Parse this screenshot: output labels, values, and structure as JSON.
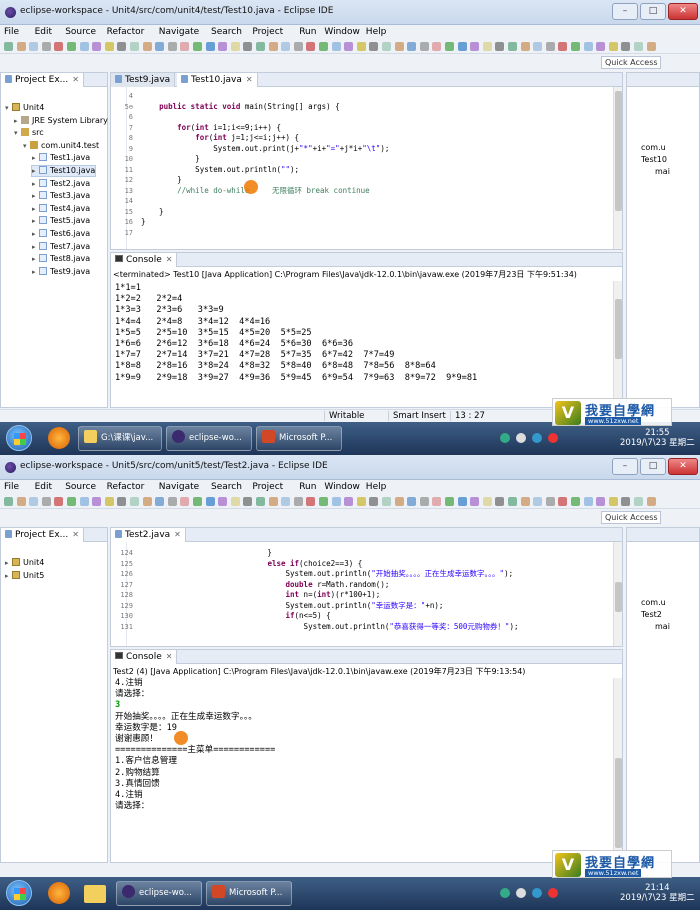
{
  "s1": {
    "title": "eclipse-workspace - Unit4/src/com/unit4/test/Test10.java - Eclipse IDE",
    "menus": [
      "File",
      "Edit",
      "Source",
      "Refactor",
      "Navigate",
      "Search",
      "Project",
      "Run",
      "Window",
      "Help"
    ],
    "quick_access": "Quick Access",
    "explorer_tab": "Project Ex...",
    "tree": [
      {
        "arrow": "▾",
        "icon": "proj",
        "label": "Unit4",
        "indent": 0
      },
      {
        "arrow": "▸",
        "icon": "jre",
        "label": "JRE System Library",
        "indent": 1
      },
      {
        "arrow": "▾",
        "icon": "src",
        "label": "src",
        "indent": 1
      },
      {
        "arrow": "▾",
        "icon": "pkg",
        "label": "com.unit4.test",
        "indent": 2
      },
      {
        "arrow": "▸",
        "icon": "java",
        "label": "Test1.java",
        "indent": 3
      },
      {
        "arrow": "▸",
        "icon": "java",
        "label": "Test10.java",
        "indent": 3,
        "selected": true
      },
      {
        "arrow": "▸",
        "icon": "java",
        "label": "Test2.java",
        "indent": 3
      },
      {
        "arrow": "▸",
        "icon": "java",
        "label": "Test3.java",
        "indent": 3
      },
      {
        "arrow": "▸",
        "icon": "java",
        "label": "Test4.java",
        "indent": 3
      },
      {
        "arrow": "▸",
        "icon": "java",
        "label": "Test5.java",
        "indent": 3
      },
      {
        "arrow": "▸",
        "icon": "java",
        "label": "Test6.java",
        "indent": 3
      },
      {
        "arrow": "▸",
        "icon": "java",
        "label": "Test7.java",
        "indent": 3
      },
      {
        "arrow": "▸",
        "icon": "java",
        "label": "Test8.java",
        "indent": 3
      },
      {
        "arrow": "▸",
        "icon": "java",
        "label": "Test9.java",
        "indent": 3
      }
    ],
    "editor_tabs": [
      "Test9.java",
      "Test10.java"
    ],
    "line_numbers": [
      "4",
      "5⊖",
      "6",
      "7",
      "8",
      "9",
      "10",
      "11",
      "12",
      "13",
      "14",
      "15",
      "16",
      "17"
    ],
    "code": [
      "",
      "    public static void main(String[] args) {",
      "",
      "        for(int i=1;i<=9;i++) {",
      "            for(int j=1;j<=i;j++) {",
      "                System.out.print(j+\"*\"+i+\"=\"+j*i+\"\\t\");",
      "            }",
      "            System.out.println(\"\");",
      "        }",
      "        //while do-while     无限循环 break continue",
      "",
      "    }",
      "}",
      ""
    ],
    "console_tab": "Console",
    "console_header": "<terminated> Test10 [Java Application] C:\\Program Files\\Java\\jdk-12.0.1\\bin\\javaw.exe (2019年7月23日 下午9:51:34)",
    "console_lines": [
      "1*1=1",
      "1*2=2   2*2=4",
      "1*3=3   2*3=6   3*3=9",
      "1*4=4   2*4=8   3*4=12  4*4=16",
      "1*5=5   2*5=10  3*5=15  4*5=20  5*5=25",
      "1*6=6   2*6=12  3*6=18  4*6=24  5*6=30  6*6=36",
      "1*7=7   2*7=14  3*7=21  4*7=28  5*7=35  6*7=42  7*7=49",
      "1*8=8   2*8=16  3*8=24  4*8=32  5*8=40  6*8=48  7*8=56  8*8=64",
      "1*9=9   2*9=18  3*9=27  4*9=36  5*9=45  6*9=54  7*9=63  8*9=72  9*9=81"
    ],
    "status": [
      "Writable",
      "Smart Insert",
      "13 : 27"
    ],
    "outline": [
      "com.u",
      "Test10",
      "mai"
    ],
    "taskbar": [
      "G:\\课课\\jav...",
      "eclipse-wo...",
      "Microsoft P..."
    ],
    "clock_time": "21:55",
    "clock_date": "2019/\\7\\23 星期二"
  },
  "s2": {
    "title": "eclipse-workspace - Unit5/src/com/unit5/test/Test2.java - Eclipse IDE",
    "menus": [
      "File",
      "Edit",
      "Source",
      "Refactor",
      "Navigate",
      "Search",
      "Project",
      "Run",
      "Window",
      "Help"
    ],
    "quick_access": "Quick Access",
    "explorer_tab": "Project Ex...",
    "tree": [
      {
        "arrow": "▸",
        "icon": "proj",
        "label": "Unit4",
        "indent": 0
      },
      {
        "arrow": "▸",
        "icon": "proj",
        "label": "Unit5",
        "indent": 0
      }
    ],
    "editor_tabs": [
      "Test2.java"
    ],
    "line_numbers": [
      "124",
      "125",
      "126",
      "127",
      "128",
      "129",
      "130",
      "131"
    ],
    "code": [
      "                            }",
      "                            else if(choice2==3) {",
      "                                System.out.println(\"开始抽奖。。。。正在生成幸运数字。。。\");",
      "                                double r=Math.random();",
      "                                int n=(int)(r*100+1);",
      "                                System.out.println(\"幸运数字是：\"+n);",
      "                                if(n<=5) {",
      "                                    System.out.println(\"恭喜获得一等奖：500元购物券！\");"
    ],
    "console_tab": "Console",
    "console_header": "Test2 (4) [Java Application] C:\\Program Files\\Java\\jdk-12.0.1\\bin\\javaw.exe (2019年7月23日 下午9:13:54)",
    "console_lines": [
      "4.注销",
      "请选择：",
      "3",
      "开始抽奖。。。。正在生成幸运数字。。。",
      "幸运数字是：19",
      "谢谢惠顾！",
      "==============主菜单============",
      "1.客户信息管理",
      "2.购物结算",
      "3.真情回馈",
      "4.注销",
      "请选择："
    ],
    "outline": [
      "com.u",
      "Test2",
      "mai"
    ],
    "taskbar": [
      "eclipse-wo...",
      "Microsoft P..."
    ],
    "clock_time": "21:14",
    "clock_date": "2019/\\7\\23 星期二"
  },
  "watermark": {
    "text": "我要自學網",
    "url": "www.51zxw.net"
  },
  "colors": {
    "keyword": "#7f0055",
    "comment": "#3f7f5f",
    "string": "#2a00ff",
    "input": "#009900"
  }
}
